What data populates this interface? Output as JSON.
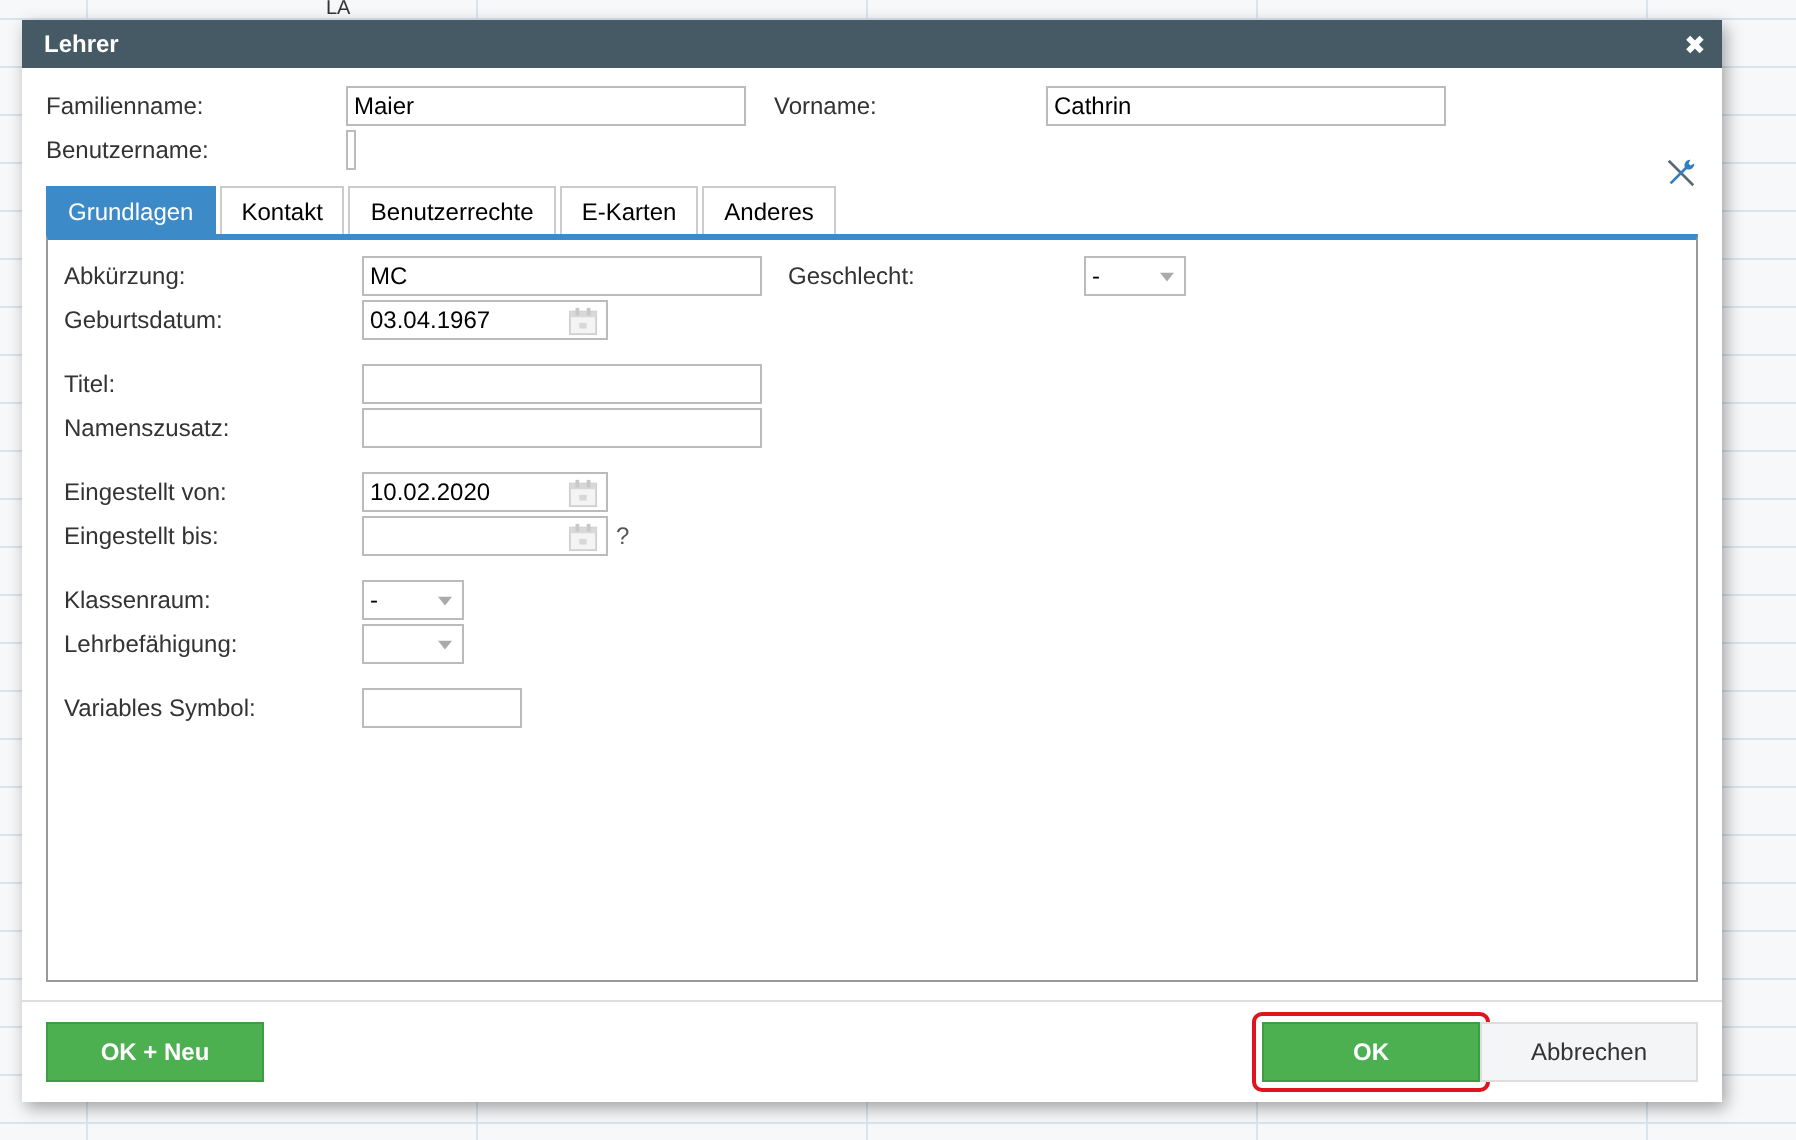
{
  "background": {
    "cell_text": "LA"
  },
  "window": {
    "title": "Lehrer",
    "close": "✖"
  },
  "header": [
    {
      "label": "Familienname:",
      "value": "Maier"
    },
    {
      "label": "Vorname:",
      "value": "Cathrin"
    },
    {
      "label": "Benutzername:"
    }
  ],
  "tabs": [
    {
      "label": "Grundlagen",
      "selected": true
    },
    {
      "label": "Kontakt",
      "selected": false
    },
    {
      "label": "Benutzerrechte",
      "selected": false
    },
    {
      "label": "E-Karten",
      "selected": false
    },
    {
      "label": "Anderes",
      "selected": false
    }
  ],
  "gender": {
    "label": "Geschlecht:",
    "value": "-"
  },
  "groups": [
    [
      {
        "label": "Abkürzung:",
        "kind": "text",
        "value": "MC"
      },
      {
        "label": "Geburtsdatum:",
        "kind": "date",
        "value": "03.04.1967"
      }
    ],
    [
      {
        "label": "Titel:",
        "kind": "text"
      },
      {
        "label": "Namenszusatz:",
        "kind": "text"
      }
    ],
    [
      {
        "label": "Eingestellt von:",
        "kind": "date",
        "value": "10.02.2020"
      },
      {
        "label": "Eingestellt bis:",
        "kind": "date",
        "hint": "?"
      }
    ],
    [
      {
        "label": "Klassenraum:",
        "kind": "select",
        "value": "-"
      },
      {
        "label": "Lehrbefähigung:",
        "kind": "select"
      }
    ],
    [
      {
        "label": "Variables Symbol:",
        "kind": "short"
      }
    ]
  ],
  "buttons": [
    {
      "label": "OK + Neu",
      "kind": "primary"
    },
    {
      "label": "OK",
      "kind": "primary",
      "highlighted": true
    },
    {
      "label": "Abbrechen",
      "kind": "secondary"
    }
  ]
}
